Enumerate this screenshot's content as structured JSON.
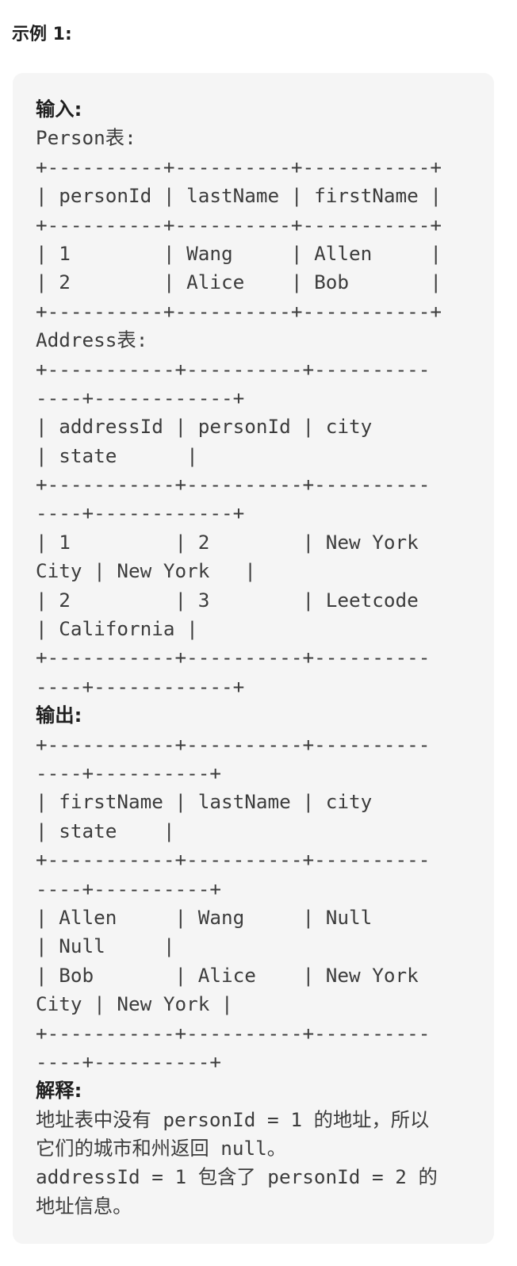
{
  "example": {
    "title": "示例 1:",
    "lines": [
      {
        "text": "输入:",
        "kind": "label"
      },
      {
        "text": "Person表:",
        "kind": "code"
      },
      {
        "text": "+----------+----------+-----------+",
        "kind": "code"
      },
      {
        "text": "| personId | lastName | firstName |",
        "kind": "code"
      },
      {
        "text": "+----------+----------+-----------+",
        "kind": "code"
      },
      {
        "text": "| 1        | Wang     | Allen     |",
        "kind": "code"
      },
      {
        "text": "| 2        | Alice    | Bob       |",
        "kind": "code"
      },
      {
        "text": "+----------+----------+-----------+",
        "kind": "code"
      },
      {
        "text": "Address表:",
        "kind": "code"
      },
      {
        "text": "+-----------+----------+----------",
        "kind": "code"
      },
      {
        "text": "----+------------+",
        "kind": "code"
      },
      {
        "text": "| addressId | personId | city",
        "kind": "code"
      },
      {
        "text": "| state      |",
        "kind": "code"
      },
      {
        "text": "+-----------+----------+----------",
        "kind": "code"
      },
      {
        "text": "----+------------+",
        "kind": "code"
      },
      {
        "text": "| 1         | 2        | New York",
        "kind": "code"
      },
      {
        "text": "City | New York   |",
        "kind": "code"
      },
      {
        "text": "| 2         | 3        | Leetcode",
        "kind": "code"
      },
      {
        "text": "| California |",
        "kind": "code"
      },
      {
        "text": "+-----------+----------+----------",
        "kind": "code"
      },
      {
        "text": "----+------------+",
        "kind": "code"
      },
      {
        "text": "输出:",
        "kind": "label"
      },
      {
        "text": "+-----------+----------+----------",
        "kind": "code"
      },
      {
        "text": "----+----------+",
        "kind": "code"
      },
      {
        "text": "| firstName | lastName | city",
        "kind": "code"
      },
      {
        "text": "| state    |",
        "kind": "code"
      },
      {
        "text": "+-----------+----------+----------",
        "kind": "code"
      },
      {
        "text": "----+----------+",
        "kind": "code"
      },
      {
        "text": "| Allen     | Wang     | Null",
        "kind": "code"
      },
      {
        "text": "| Null     |",
        "kind": "code"
      },
      {
        "text": "| Bob       | Alice    | New York",
        "kind": "code"
      },
      {
        "text": "City | New York |",
        "kind": "code"
      },
      {
        "text": "+-----------+----------+----------",
        "kind": "code"
      },
      {
        "text": "----+----------+",
        "kind": "code"
      },
      {
        "text": "解释:",
        "kind": "label"
      },
      {
        "text": "地址表中没有 personId = 1 的地址，所以",
        "kind": "code"
      },
      {
        "text": "它们的城市和州返回 null。",
        "kind": "code"
      },
      {
        "text": "addressId = 1 包含了 personId = 2 的",
        "kind": "code"
      },
      {
        "text": "地址信息。",
        "kind": "code"
      }
    ]
  }
}
